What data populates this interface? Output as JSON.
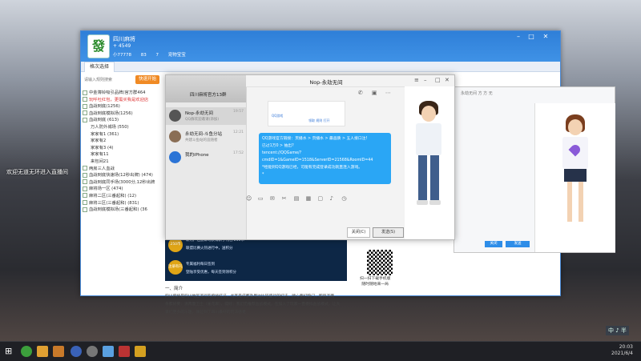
{
  "stream_overlay": "欢迎无道无环进入直播间",
  "lobby": {
    "title": "四川麻将",
    "user_line": "+ 4549",
    "stats": [
      "小77778",
      "83",
      "7",
      "宠物宝宝"
    ],
    "tab_label": "格次选择",
    "search_placeholder": "请输入规则搜索",
    "enter_button": "快速开始",
    "tree": [
      {
        "label": "中金簿铃吸引品牌(官方群464",
        "level": 1,
        "red": false
      },
      {
        "label": "玩呼吐红包，更需买我是欢迎店",
        "level": 1,
        "red": true
      },
      {
        "label": "血战到底(1256)",
        "level": 1,
        "red": false
      },
      {
        "label": "血战到底模拟场(1256)",
        "level": 1,
        "red": false
      },
      {
        "label": "血战到底 (613)",
        "level": 1,
        "red": false
      },
      {
        "label": "万人防外城场 (550)",
        "level": 2,
        "red": false
      },
      {
        "label": "家家有1 (361)",
        "level": 2,
        "red": false
      },
      {
        "label": "家家有2",
        "level": 2,
        "red": false
      },
      {
        "label": "家家有3 (4)",
        "level": 2,
        "red": false
      },
      {
        "label": "家家有11",
        "level": 2,
        "red": false
      },
      {
        "label": "来包间21",
        "level": 2,
        "red": false
      },
      {
        "label": "两房三人血战",
        "level": 1,
        "red": false
      },
      {
        "label": "血战到底快速场(12秒出牌) (474)",
        "level": 1,
        "red": false
      },
      {
        "label": "血战到底同手场(3000分,12秒出牌",
        "level": 1,
        "red": false
      },
      {
        "label": "麻将场一区 (474)",
        "level": 1,
        "red": false
      },
      {
        "label": "麻将二区(三番起和) (12)",
        "level": 1,
        "red": false
      },
      {
        "label": "麻将三区(三番起和) (831)",
        "level": 1,
        "red": false
      },
      {
        "label": "血战到底模拟场(三番起和) (36",
        "level": 1,
        "red": false
      }
    ]
  },
  "page": {
    "promo_lines": [
      "新用户注册即可获得新手礼包 250币",
      "联盟比赛火热进行中，送积分",
      "专属福利每日签到",
      "登陆享受优惠，每天签到领积分"
    ],
    "promo_badges": [
      "250币",
      "注册有礼"
    ],
    "heading": "一、简介",
    "paragraphs": [
      "四川麻将是四川地区流行的麻将打法，尤其是成都及周边比较盛行的打法，牌心要打缺门，即四万两",
      "条都好要：清两面卫士（雀花麻），得好：我们仍推荐血战模式，在加入了玩家一直模拟血战模式，让大",
      "家们更多的乐趣，体验到了四川最好的玩法感觉"
    ],
    "qr_caption": [
      "扫一扫下载手机版",
      "随时随地来一局"
    ]
  },
  "qq": {
    "group_banner": "四川麻将官方13群",
    "conversations": [
      {
        "name": "Nop-永劫无间",
        "preview": "QQ群欢迎邀请(添加)",
        "time": "19:57"
      },
      {
        "name": "永劫无间-斗鱼分站",
        "preview": "共建斗鱼站的追随者",
        "time": "12:21"
      },
      {
        "name": "我的iPhone",
        "preview": "",
        "time": "17:52"
      }
    ],
    "title": "Nop-永劫无间",
    "card_label": "QQ游戏",
    "card_actions": [
      "领取",
      "规则",
      "打开"
    ],
    "bubble_lines": [
      "QQ游戏官方链接：页播水 > 页播水 > 最画质 > 五人接口注!",
      "已过1万0 > 抽出?",
      "tencent://QQGame/?",
      "cmdID=1&GameID=1518&ServerID=21568&RoomID=44",
      "*经能到QQ游戏已经，可能有完成登录成功就直连入游戏。",
      "*"
    ],
    "close_button": "关闭(C)",
    "send_button": "发送(S)"
  },
  "chat2": {
    "title": "永劫无间 方 方 无",
    "ok_button": "关闭",
    "send_button": "发送"
  },
  "watermark": "中 ♪ 半",
  "tray": {
    "time": "20:03",
    "date": "2021/6/4"
  }
}
